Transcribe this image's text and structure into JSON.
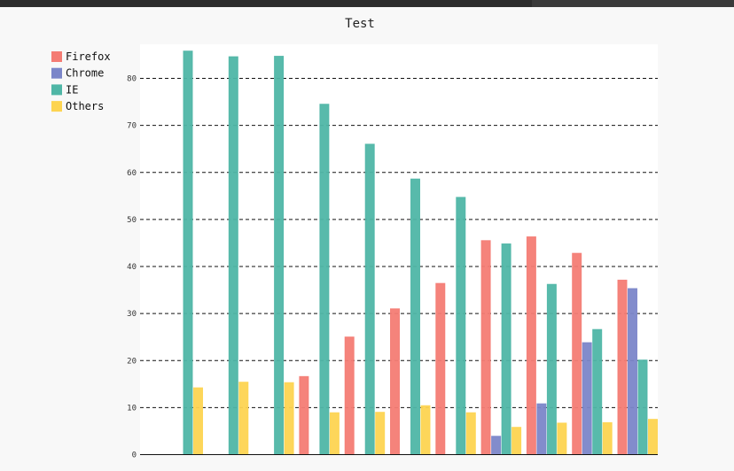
{
  "chart_data": {
    "type": "bar",
    "title": "Test",
    "xlabel": "",
    "ylabel": "",
    "ylim": [
      0,
      88
    ],
    "yticks": [
      0,
      10,
      20,
      30,
      40,
      50,
      60,
      70,
      80
    ],
    "grid": "horizontal dashed",
    "legend_position": "top-left",
    "categories": [
      "",
      "",
      "",
      "",
      "",
      "",
      "",
      "",
      "",
      "",
      ""
    ],
    "series": [
      {
        "name": "Firefox",
        "color": "#f47c74",
        "values": [
          null,
          null,
          null,
          16.6,
          25.0,
          31.0,
          36.4,
          45.5,
          46.3,
          42.8,
          37.1
        ]
      },
      {
        "name": "Chrome",
        "color": "#7b86c9",
        "values": [
          null,
          null,
          null,
          null,
          null,
          null,
          null,
          3.9,
          10.8,
          23.8,
          35.3
        ]
      },
      {
        "name": "IE",
        "color": "#4fb6a6",
        "values": [
          85.8,
          84.6,
          84.7,
          74.5,
          66.0,
          58.6,
          54.7,
          44.8,
          36.2,
          26.6,
          20.1
        ]
      },
      {
        "name": "Others",
        "color": "#fdd451",
        "values": [
          14.2,
          15.4,
          15.3,
          8.9,
          9.0,
          10.4,
          8.9,
          5.8,
          6.7,
          6.8,
          7.5
        ]
      }
    ]
  }
}
